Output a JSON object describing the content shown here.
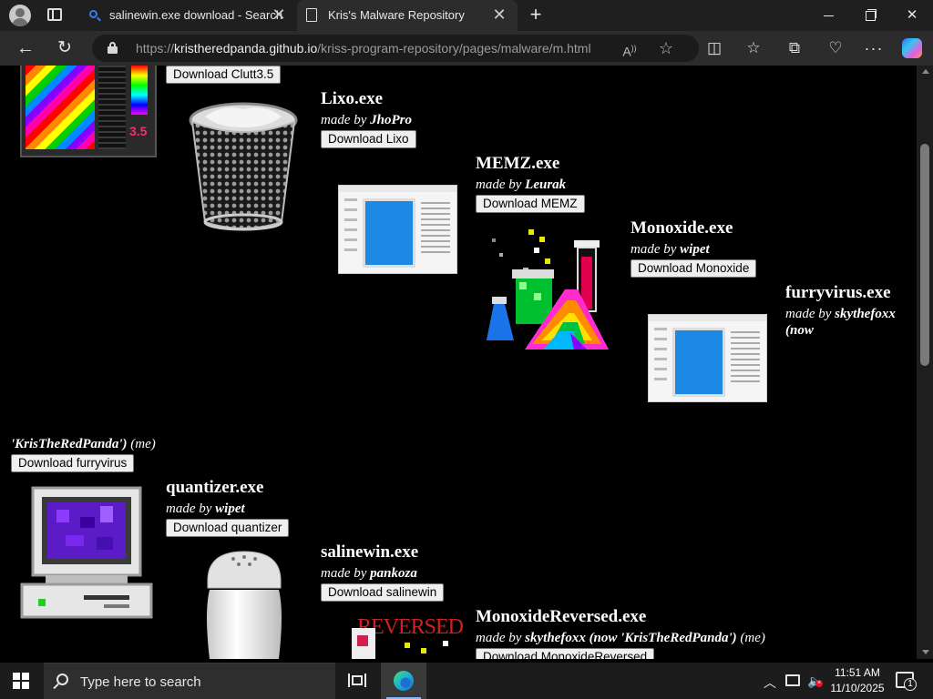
{
  "browser": {
    "tabs": [
      {
        "title": "salinewin.exe download - Search",
        "icon": "search-icon",
        "active": false
      },
      {
        "title": "Kris's Malware Repository",
        "icon": "page-icon",
        "active": true
      }
    ],
    "address": {
      "scheme": "https://",
      "host": "kristheredpanda.github.io",
      "path": "/kriss-program-repository/pages/malware/m.html"
    }
  },
  "page": {
    "entries": [
      {
        "id": "clutt",
        "button": "Download Clutt3.5",
        "badge": "3.5"
      },
      {
        "id": "lixo",
        "name": "Lixo.exe",
        "by_prefix": "made by ",
        "author": "JhoPro",
        "button": "Download Lixo"
      },
      {
        "id": "memz",
        "name": "MEMZ.exe",
        "by_prefix": "made by ",
        "author": "Leurak",
        "button": "Download MEMZ"
      },
      {
        "id": "monoxide",
        "name": "Monoxide.exe",
        "by_prefix": "made by ",
        "author": "wipet",
        "button": "Download Monoxide"
      },
      {
        "id": "furryvirus",
        "name": "furryvirus.exe",
        "by_prefix": "made by ",
        "author": "skythefoxx",
        "author_note_1": "(now",
        "author_note_2": "'KrisTheRedPanda')",
        "author_note_3": " (me)",
        "button": "Download furryvirus"
      },
      {
        "id": "quantizer",
        "name": "quantizer.exe",
        "by_prefix": "made by ",
        "author": "wipet",
        "button": "Download quantizer"
      },
      {
        "id": "salinewin",
        "name": "salinewin.exe",
        "by_prefix": "made by ",
        "author": "pankoza",
        "button": "Download salinewin"
      },
      {
        "id": "monoxidereversed",
        "name": "MonoxideReversed.exe",
        "by_prefix": "made by ",
        "author": "skythefoxx (now 'KrisTheRedPanda')",
        "author_note": " (me)",
        "button": "Download MonoxideReversed",
        "art_text": "REVERSED"
      }
    ]
  },
  "taskbar": {
    "search_placeholder": "Type here to search",
    "time": "11:51 AM",
    "date": "11/10/2025",
    "notifications": "1"
  },
  "colors": {
    "accent_blue": "#2f80ed",
    "page_background": "#000000",
    "reversed_red": "#d02020"
  }
}
